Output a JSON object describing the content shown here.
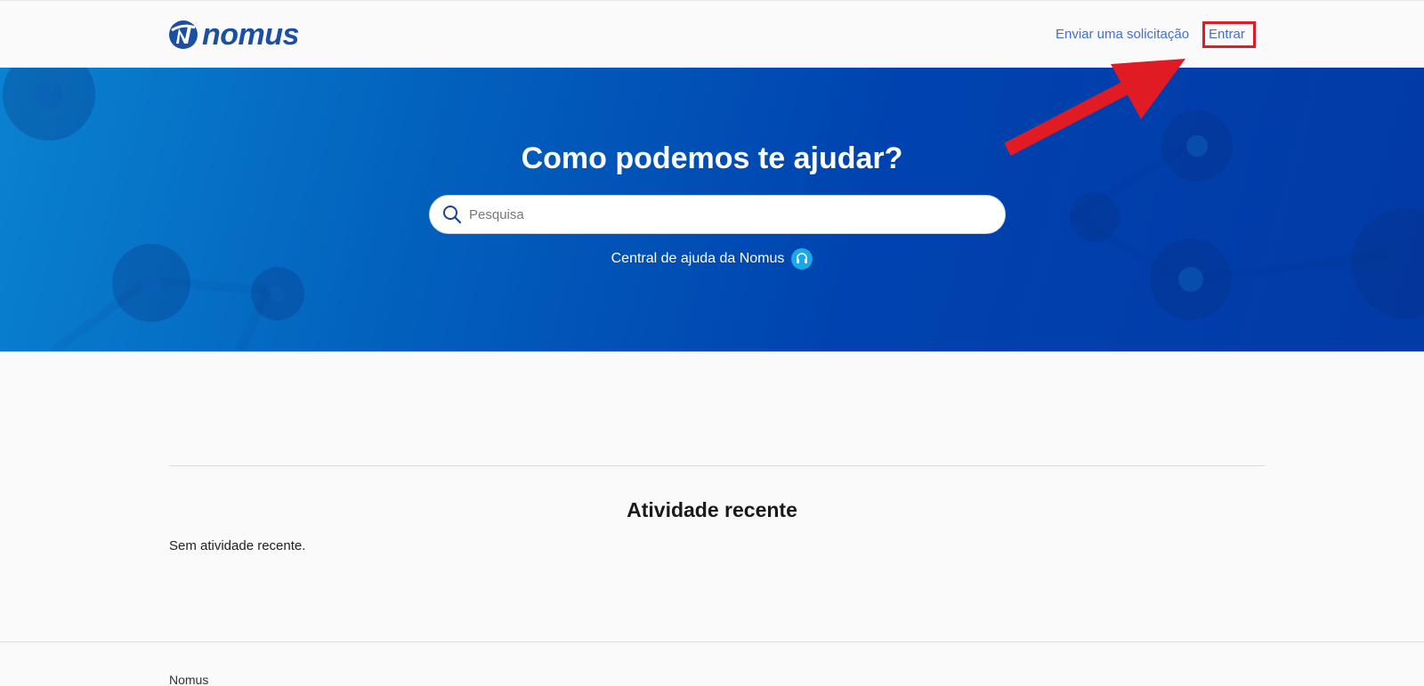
{
  "header": {
    "logo_text": "nomus",
    "submit_request_label": "Enviar uma solicitação",
    "login_label": "Entrar"
  },
  "hero": {
    "title": "Como podemos te ajudar?",
    "search_placeholder": "Pesquisa",
    "help_center_label": "Central de ajuda da Nomus"
  },
  "recent": {
    "title": "Atividade recente",
    "empty_message": "Sem atividade recente."
  },
  "footer": {
    "brand": "Nomus"
  },
  "colors": {
    "brand_blue": "#1a4fa3",
    "link_blue": "#3f6fd8",
    "highlight_red": "#e01b24",
    "hero_blue": "#0043b0"
  }
}
